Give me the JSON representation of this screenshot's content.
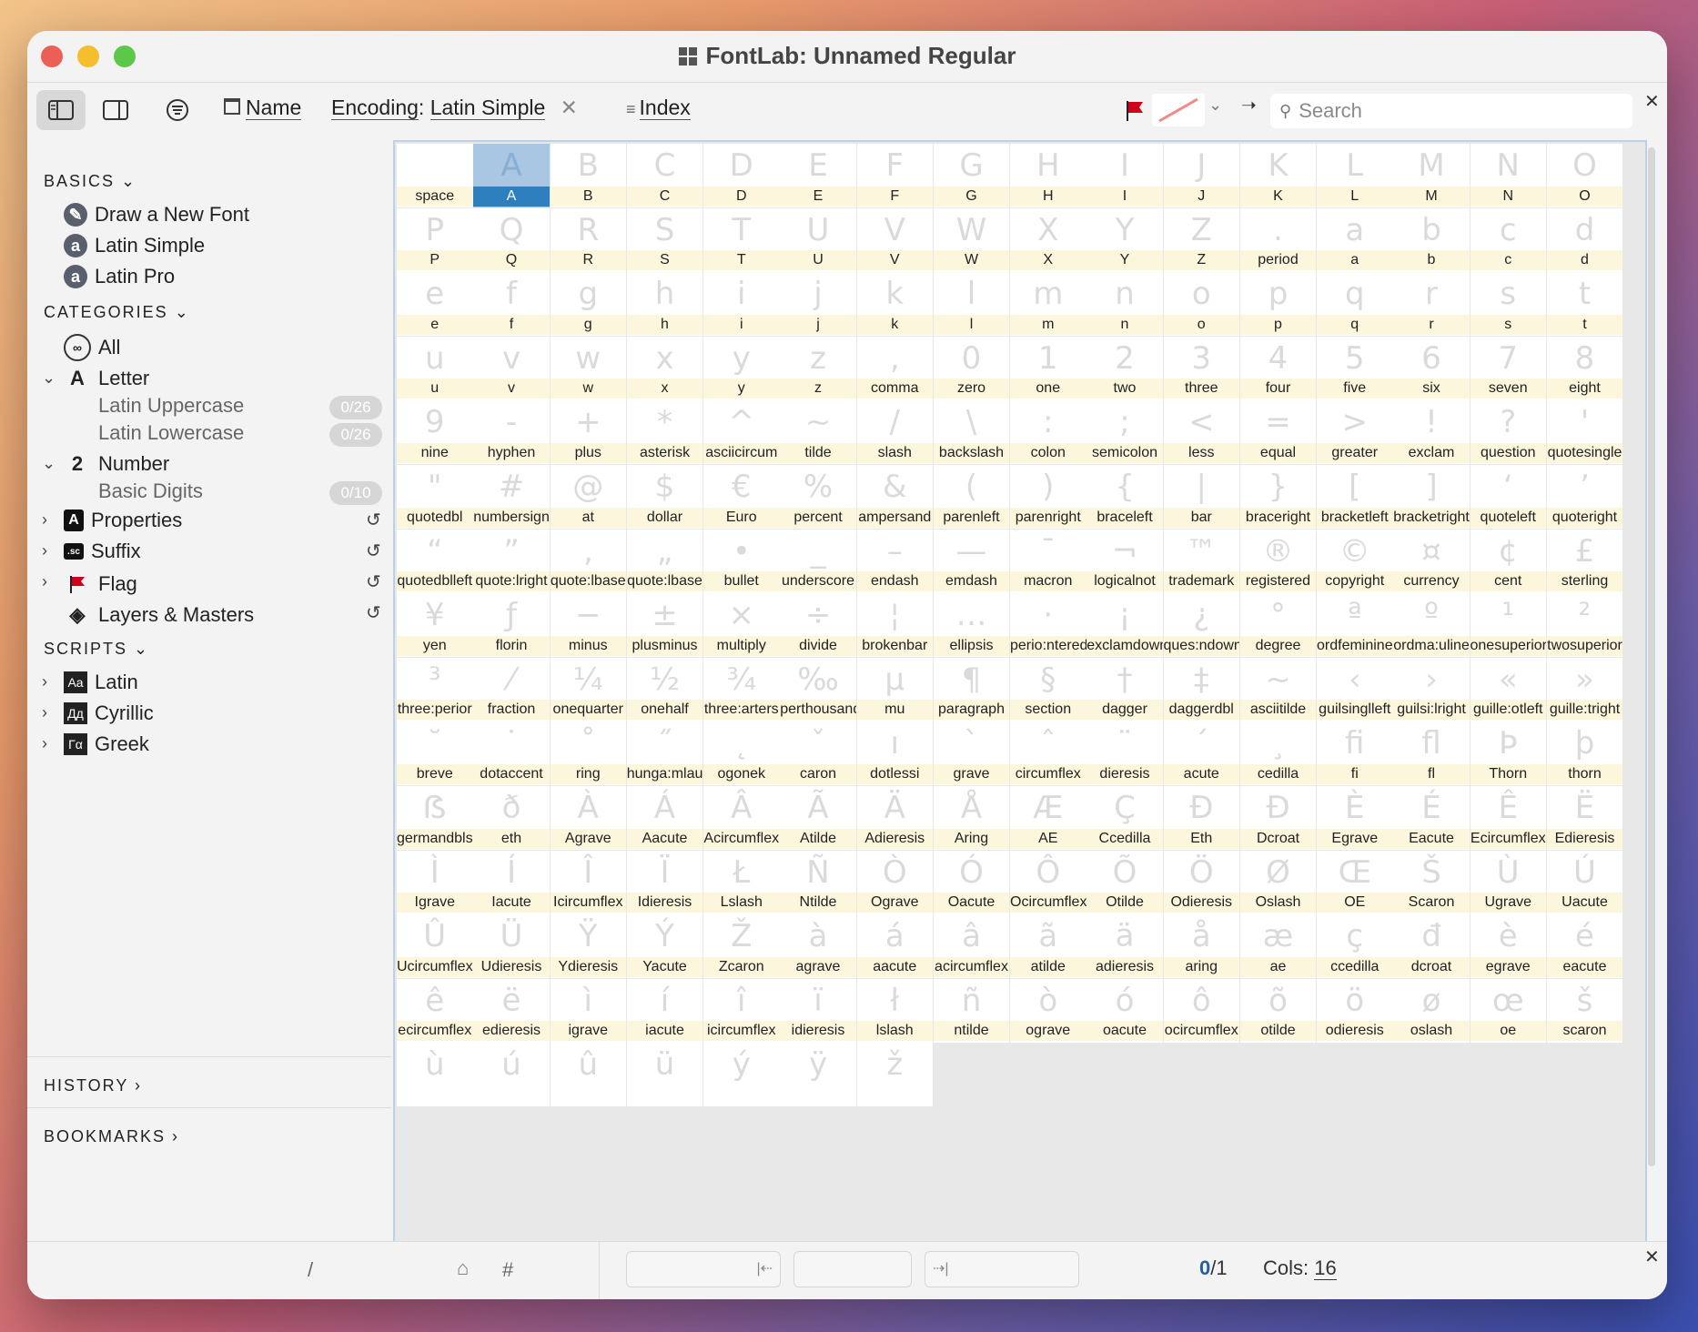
{
  "window": {
    "title": "FontLab: Unnamed Regular"
  },
  "toolbar": {
    "name_label": "Name",
    "encoding_label": "Encoding",
    "encoding_value": "Latin Simple",
    "index_label": "Index",
    "search_placeholder": "Search",
    "flag_color": "#d0021b"
  },
  "sidebar": {
    "basics_title": "BASICS",
    "basics": [
      "Draw a New Font",
      "Latin Simple",
      "Latin Pro"
    ],
    "categories_title": "CATEGORIES",
    "all_label": "All",
    "letter_label": "Letter",
    "latin_uppercase": {
      "label": "Latin Uppercase",
      "count": "0/26"
    },
    "latin_lowercase": {
      "label": "Latin Lowercase",
      "count": "0/26"
    },
    "number_label": "Number",
    "basic_digits": {
      "label": "Basic Digits",
      "count": "0/10"
    },
    "properties_label": "Properties",
    "suffix_label": "Suffix",
    "flag_label": "Flag",
    "layers_label": "Layers & Masters",
    "scripts_title": "SCRIPTS",
    "scripts": [
      "Latin",
      "Cyrillic",
      "Greek"
    ],
    "script_icons": [
      "Aa",
      "Дд",
      "Γα"
    ],
    "history_label": "HISTORY",
    "bookmarks_label": "BOOKMARKS"
  },
  "status": {
    "count": "0",
    "total": "/1",
    "cols_label": "Cols:",
    "cols_value": "16",
    "slash": "/",
    "hash": "#"
  },
  "glyphs": [
    [
      "",
      "space"
    ],
    [
      "A",
      "A"
    ],
    [
      "B",
      "B"
    ],
    [
      "C",
      "C"
    ],
    [
      "D",
      "D"
    ],
    [
      "E",
      "E"
    ],
    [
      "F",
      "F"
    ],
    [
      "G",
      "G"
    ],
    [
      "H",
      "H"
    ],
    [
      "I",
      "I"
    ],
    [
      "J",
      "J"
    ],
    [
      "K",
      "K"
    ],
    [
      "L",
      "L"
    ],
    [
      "M",
      "M"
    ],
    [
      "N",
      "N"
    ],
    [
      "O",
      "O"
    ],
    [
      "P",
      "P"
    ],
    [
      "Q",
      "Q"
    ],
    [
      "R",
      "R"
    ],
    [
      "S",
      "S"
    ],
    [
      "T",
      "T"
    ],
    [
      "U",
      "U"
    ],
    [
      "V",
      "V"
    ],
    [
      "W",
      "W"
    ],
    [
      "X",
      "X"
    ],
    [
      "Y",
      "Y"
    ],
    [
      "Z",
      "Z"
    ],
    [
      ".",
      "period"
    ],
    [
      "a",
      "a"
    ],
    [
      "b",
      "b"
    ],
    [
      "c",
      "c"
    ],
    [
      "d",
      "d"
    ],
    [
      "e",
      "e"
    ],
    [
      "f",
      "f"
    ],
    [
      "g",
      "g"
    ],
    [
      "h",
      "h"
    ],
    [
      "i",
      "i"
    ],
    [
      "j",
      "j"
    ],
    [
      "k",
      "k"
    ],
    [
      "l",
      "l"
    ],
    [
      "m",
      "m"
    ],
    [
      "n",
      "n"
    ],
    [
      "o",
      "o"
    ],
    [
      "p",
      "p"
    ],
    [
      "q",
      "q"
    ],
    [
      "r",
      "r"
    ],
    [
      "s",
      "s"
    ],
    [
      "t",
      "t"
    ],
    [
      "u",
      "u"
    ],
    [
      "v",
      "v"
    ],
    [
      "w",
      "w"
    ],
    [
      "x",
      "x"
    ],
    [
      "y",
      "y"
    ],
    [
      "z",
      "z"
    ],
    [
      ",",
      "comma"
    ],
    [
      "0",
      "zero"
    ],
    [
      "1",
      "one"
    ],
    [
      "2",
      "two"
    ],
    [
      "3",
      "three"
    ],
    [
      "4",
      "four"
    ],
    [
      "5",
      "five"
    ],
    [
      "6",
      "six"
    ],
    [
      "7",
      "seven"
    ],
    [
      "8",
      "eight"
    ],
    [
      "9",
      "nine"
    ],
    [
      "-",
      "hyphen"
    ],
    [
      "+",
      "plus"
    ],
    [
      "*",
      "asterisk"
    ],
    [
      "^",
      "asciicircum"
    ],
    [
      "~",
      "tilde"
    ],
    [
      "/",
      "slash"
    ],
    [
      "\\",
      "backslash"
    ],
    [
      ":",
      "colon"
    ],
    [
      ";",
      "semicolon"
    ],
    [
      "<",
      "less"
    ],
    [
      "=",
      "equal"
    ],
    [
      ">",
      "greater"
    ],
    [
      "!",
      "exclam"
    ],
    [
      "?",
      "question"
    ],
    [
      "'",
      "quotesingle"
    ],
    [
      "\"",
      "quotedbl"
    ],
    [
      "#",
      "numbersign"
    ],
    [
      "@",
      "at"
    ],
    [
      "$",
      "dollar"
    ],
    [
      "€",
      "Euro"
    ],
    [
      "%",
      "percent"
    ],
    [
      "&",
      "ampersand"
    ],
    [
      "(",
      "parenleft"
    ],
    [
      ")",
      "parenright"
    ],
    [
      "{",
      "braceleft"
    ],
    [
      "|",
      "bar"
    ],
    [
      "}",
      "braceright"
    ],
    [
      "[",
      "bracketleft"
    ],
    [
      "]",
      "bracketright"
    ],
    [
      "‘",
      "quoteleft"
    ],
    [
      "’",
      "quoteright"
    ],
    [
      "“",
      "quotedblleft"
    ],
    [
      "”",
      "quote:lright"
    ],
    [
      "‚",
      "quote:lbase"
    ],
    [
      "„",
      "quote:lbase"
    ],
    [
      "•",
      "bullet"
    ],
    [
      "_",
      "underscore"
    ],
    [
      "–",
      "endash"
    ],
    [
      "—",
      "emdash"
    ],
    [
      "¯",
      "macron"
    ],
    [
      "¬",
      "logicalnot"
    ],
    [
      "™",
      "trademark"
    ],
    [
      "®",
      "registered"
    ],
    [
      "©",
      "copyright"
    ],
    [
      "¤",
      "currency"
    ],
    [
      "¢",
      "cent"
    ],
    [
      "£",
      "sterling"
    ],
    [
      "¥",
      "yen"
    ],
    [
      "ƒ",
      "florin"
    ],
    [
      "−",
      "minus"
    ],
    [
      "±",
      "plusminus"
    ],
    [
      "×",
      "multiply"
    ],
    [
      "÷",
      "divide"
    ],
    [
      "¦",
      "brokenbar"
    ],
    [
      "…",
      "ellipsis"
    ],
    [
      "·",
      "perio:ntered"
    ],
    [
      "¡",
      "exclamdown"
    ],
    [
      "¿",
      "ques:ndown"
    ],
    [
      "°",
      "degree"
    ],
    [
      "ª",
      "ordfeminine"
    ],
    [
      "º",
      "ordma:uline"
    ],
    [
      "¹",
      "onesuperior"
    ],
    [
      "²",
      "twosuperior"
    ],
    [
      "³",
      "three:perior"
    ],
    [
      "⁄",
      "fraction"
    ],
    [
      "¼",
      "onequarter"
    ],
    [
      "½",
      "onehalf"
    ],
    [
      "¾",
      "three:arters"
    ],
    [
      "‰",
      "perthousand"
    ],
    [
      "µ",
      "mu"
    ],
    [
      "¶",
      "paragraph"
    ],
    [
      "§",
      "section"
    ],
    [
      "†",
      "dagger"
    ],
    [
      "‡",
      "daggerdbl"
    ],
    [
      "~",
      "asciitilde"
    ],
    [
      "‹",
      "guilsinglleft"
    ],
    [
      "›",
      "guilsi:lright"
    ],
    [
      "«",
      "guille:otleft"
    ],
    [
      "»",
      "guille:tright"
    ],
    [
      "˘",
      "breve"
    ],
    [
      "˙",
      "dotaccent"
    ],
    [
      "˚",
      "ring"
    ],
    [
      "˝",
      "hunga:mlaut"
    ],
    [
      "˛",
      "ogonek"
    ],
    [
      "ˇ",
      "caron"
    ],
    [
      "ı",
      "dotlessi"
    ],
    [
      "`",
      "grave"
    ],
    [
      "ˆ",
      "circumflex"
    ],
    [
      "¨",
      "dieresis"
    ],
    [
      "´",
      "acute"
    ],
    [
      "¸",
      "cedilla"
    ],
    [
      "ﬁ",
      "fi"
    ],
    [
      "ﬂ",
      "fl"
    ],
    [
      "Þ",
      "Thorn"
    ],
    [
      "þ",
      "thorn"
    ],
    [
      "ẞ",
      "germandbls"
    ],
    [
      "ð",
      "eth"
    ],
    [
      "À",
      "Agrave"
    ],
    [
      "Á",
      "Aacute"
    ],
    [
      "Â",
      "Acircumflex"
    ],
    [
      "Ã",
      "Atilde"
    ],
    [
      "Ä",
      "Adieresis"
    ],
    [
      "Å",
      "Aring"
    ],
    [
      "Æ",
      "AE"
    ],
    [
      "Ç",
      "Ccedilla"
    ],
    [
      "Ð",
      "Eth"
    ],
    [
      "Đ",
      "Dcroat"
    ],
    [
      "È",
      "Egrave"
    ],
    [
      "É",
      "Eacute"
    ],
    [
      "Ê",
      "Ecircumflex"
    ],
    [
      "Ë",
      "Edieresis"
    ],
    [
      "Ì",
      "Igrave"
    ],
    [
      "Í",
      "Iacute"
    ],
    [
      "Î",
      "Icircumflex"
    ],
    [
      "Ï",
      "Idieresis"
    ],
    [
      "Ł",
      "Lslash"
    ],
    [
      "Ñ",
      "Ntilde"
    ],
    [
      "Ò",
      "Ograve"
    ],
    [
      "Ó",
      "Oacute"
    ],
    [
      "Ô",
      "Ocircumflex"
    ],
    [
      "Õ",
      "Otilde"
    ],
    [
      "Ö",
      "Odieresis"
    ],
    [
      "Ø",
      "Oslash"
    ],
    [
      "Œ",
      "OE"
    ],
    [
      "Š",
      "Scaron"
    ],
    [
      "Ù",
      "Ugrave"
    ],
    [
      "Ú",
      "Uacute"
    ],
    [
      "Û",
      "Ucircumflex"
    ],
    [
      "Ü",
      "Udieresis"
    ],
    [
      "Ÿ",
      "Ydieresis"
    ],
    [
      "Ý",
      "Yacute"
    ],
    [
      "Ž",
      "Zcaron"
    ],
    [
      "à",
      "agrave"
    ],
    [
      "á",
      "aacute"
    ],
    [
      "â",
      "acircumflex"
    ],
    [
      "ã",
      "atilde"
    ],
    [
      "ä",
      "adieresis"
    ],
    [
      "å",
      "aring"
    ],
    [
      "æ",
      "ae"
    ],
    [
      "ç",
      "ccedilla"
    ],
    [
      "đ",
      "dcroat"
    ],
    [
      "è",
      "egrave"
    ],
    [
      "é",
      "eacute"
    ],
    [
      "ê",
      "ecircumflex"
    ],
    [
      "ë",
      "edieresis"
    ],
    [
      "ì",
      "igrave"
    ],
    [
      "í",
      "iacute"
    ],
    [
      "î",
      "icircumflex"
    ],
    [
      "ï",
      "idieresis"
    ],
    [
      "ł",
      "lslash"
    ],
    [
      "ñ",
      "ntilde"
    ],
    [
      "ò",
      "ograve"
    ],
    [
      "ó",
      "oacute"
    ],
    [
      "ô",
      "ocircumflex"
    ],
    [
      "õ",
      "otilde"
    ],
    [
      "ö",
      "odieresis"
    ],
    [
      "ø",
      "oslash"
    ],
    [
      "œ",
      "oe"
    ],
    [
      "š",
      "scaron"
    ],
    [
      "ù",
      ""
    ],
    [
      "ú",
      ""
    ],
    [
      "û",
      ""
    ],
    [
      "ü",
      ""
    ],
    [
      "ý",
      ""
    ],
    [
      "ÿ",
      ""
    ],
    [
      "ž",
      ""
    ]
  ],
  "selected_glyph": "A"
}
